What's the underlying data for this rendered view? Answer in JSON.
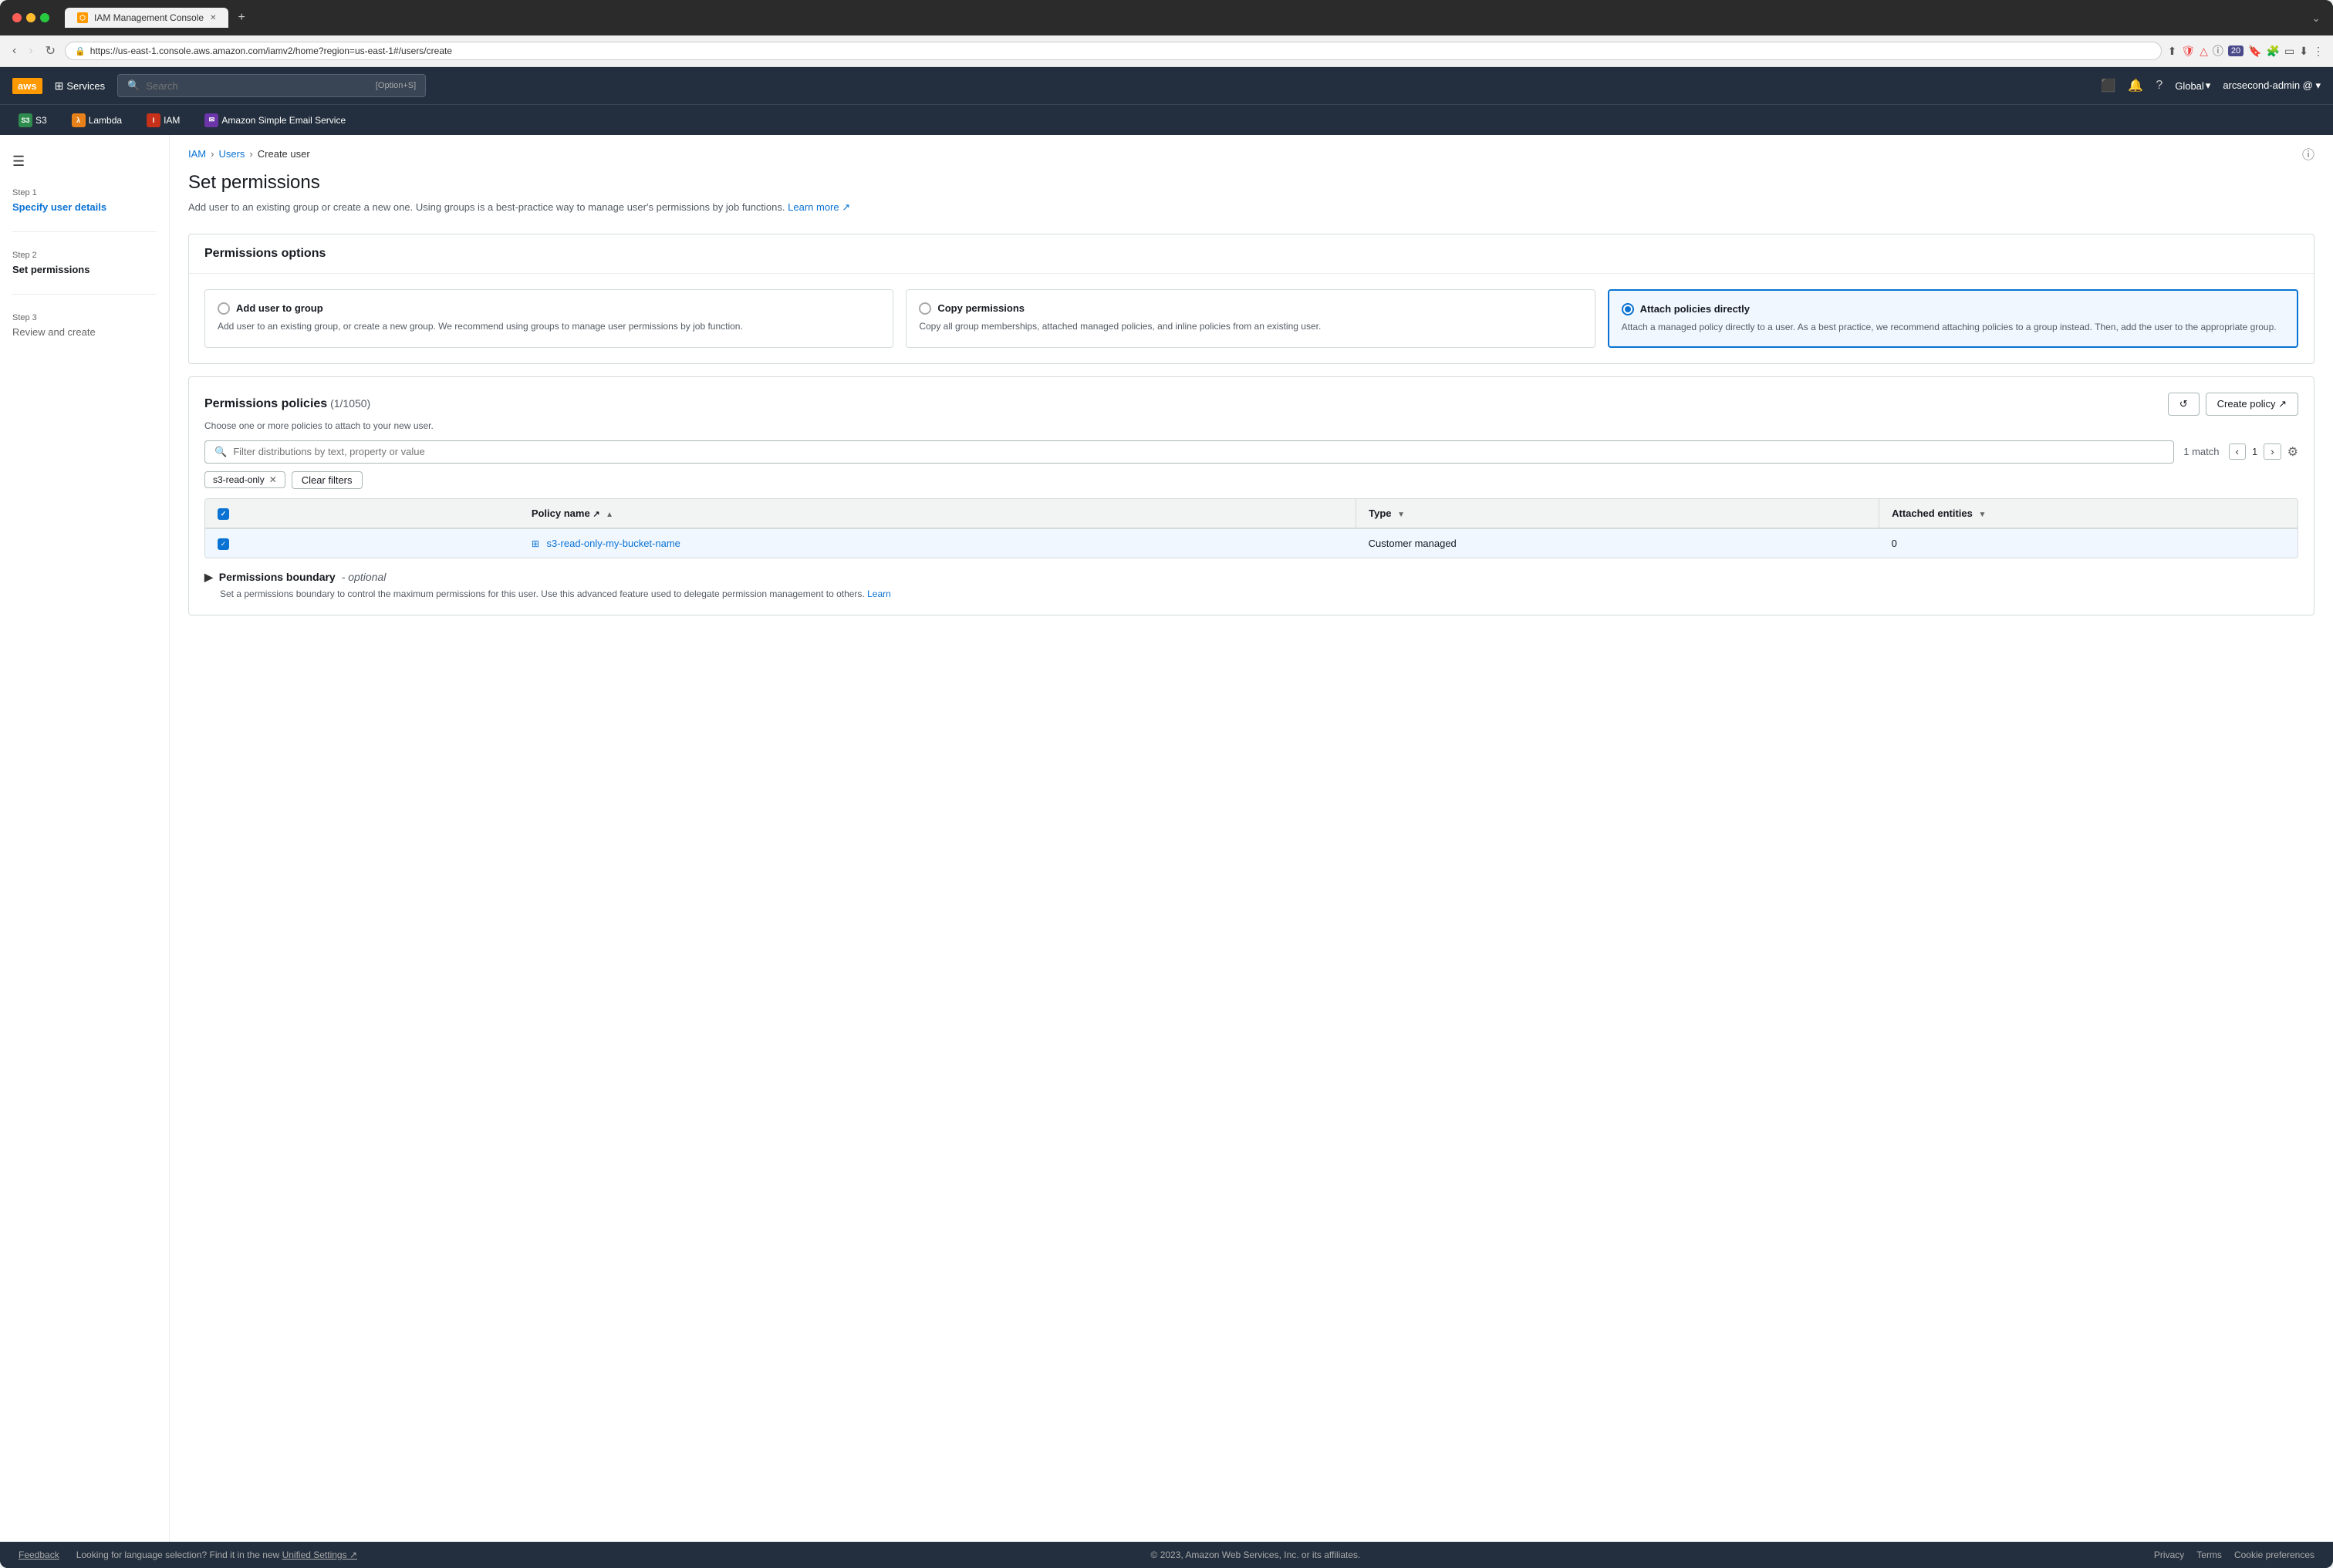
{
  "browser": {
    "tab_title": "IAM Management Console",
    "url": "https://us-east-1.console.aws.amazon.com/iamv2/home?region=us-east-1#/users/create",
    "new_tab_symbol": "+",
    "back_btn": "‹",
    "forward_btn": "›",
    "reload_btn": "↻"
  },
  "aws_header": {
    "logo": "aws",
    "services_label": "Services",
    "search_placeholder": "Search",
    "search_shortcut": "[Option+S]",
    "global_label": "Global",
    "user_label": "arcsecond-admin @",
    "shortcuts": [
      {
        "label": "S3",
        "badge_color": "#2d8c4e",
        "badge_text": "S3"
      },
      {
        "label": "Lambda",
        "badge_color": "#e8811a",
        "badge_text": "λ"
      },
      {
        "label": "IAM",
        "badge_color": "#c7311a",
        "badge_text": "IAM"
      },
      {
        "label": "Amazon Simple Email Service",
        "badge_color": "#6c35a9",
        "badge_text": "SES"
      }
    ]
  },
  "breadcrumb": {
    "items": [
      "IAM",
      "Users",
      "Create user"
    ]
  },
  "steps": [
    {
      "step_num": "Step 1",
      "label": "Specify user details",
      "state": "link"
    },
    {
      "step_num": "Step 2",
      "label": "Set permissions",
      "state": "active"
    },
    {
      "step_num": "Step 3",
      "label": "Review and create",
      "state": "inactive"
    }
  ],
  "page": {
    "title": "Set permissions",
    "description": "Add user to an existing group or create a new one. Using groups is a best-practice way to manage user's permissions by job functions.",
    "learn_more_label": "Learn more"
  },
  "permissions_options": {
    "section_title": "Permissions options",
    "options": [
      {
        "id": "add-to-group",
        "title": "Add user to group",
        "description": "Add user to an existing group, or create a new group. We recommend using groups to manage user permissions by job function.",
        "selected": false
      },
      {
        "id": "copy-permissions",
        "title": "Copy permissions",
        "description": "Copy all group memberships, attached managed policies, and inline policies from an existing user.",
        "selected": false
      },
      {
        "id": "attach-policies",
        "title": "Attach policies directly",
        "description": "Attach a managed policy directly to a user. As a best practice, we recommend attaching policies to a group instead. Then, add the user to the appropriate group.",
        "selected": true
      }
    ]
  },
  "permissions_policies": {
    "title": "Permissions policies",
    "count": "(1/1050)",
    "description": "Choose one or more policies to attach to your new user.",
    "refresh_label": "↺",
    "create_policy_label": "Create policy ↗",
    "filter_placeholder": "Filter distributions by text, property or value",
    "match_count": "1 match",
    "page_num": "1",
    "filter_tag": "s3-read-only",
    "clear_filters_label": "Clear filters",
    "columns": [
      {
        "id": "policy-name",
        "label": "Policy name ↗",
        "sortable": true
      },
      {
        "id": "type",
        "label": "Type",
        "sortable": true
      },
      {
        "id": "attached-entities",
        "label": "Attached entities",
        "sortable": true
      }
    ],
    "rows": [
      {
        "checked": true,
        "policy_name": "s3-read-only-my-bucket-name",
        "type": "Customer managed",
        "attached_entities": "0"
      }
    ]
  },
  "permissions_boundary": {
    "title": "Permissions boundary",
    "optional_label": "- optional",
    "description": "Set a permissions boundary to control the maximum permissions for this user. Use this advanced feature used to delegate permission management to others.",
    "learn_more": "Learn"
  },
  "footer": {
    "feedback_label": "Feedback",
    "unified_settings_label": "Unified Settings ↗",
    "unified_settings_prefix": "Looking for language selection? Find it in the new",
    "copyright": "© 2023, Amazon Web Services, Inc. or its affiliates.",
    "privacy_label": "Privacy",
    "terms_label": "Terms",
    "cookie_prefs_label": "Cookie preferences"
  }
}
